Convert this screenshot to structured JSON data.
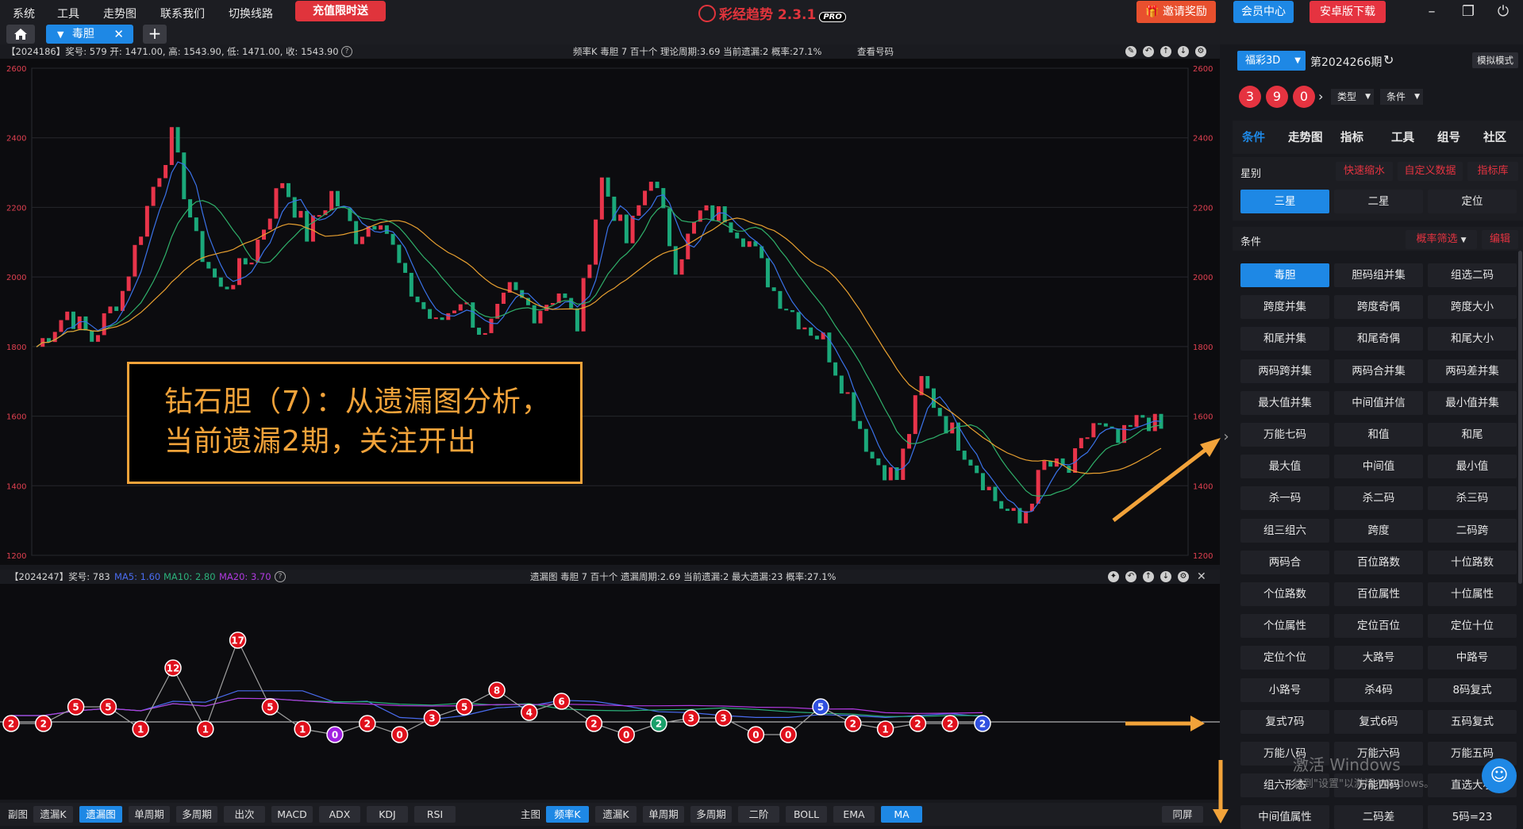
{
  "topbar": {
    "menu": [
      "系统",
      "工具",
      "走势图",
      "联系我们",
      "切换线路"
    ],
    "promo": "充值限时送",
    "app_title": "彩经趋势 2.3.1",
    "app_badge": "PRO",
    "invite": "邀请奖励",
    "member": "会员中心",
    "android": "安卓版下载"
  },
  "tabs": {
    "active": "毒胆"
  },
  "main_chart": {
    "info": "【2024186】奖号: 579  开: 1471.00, 高: 1543.90, 低: 1471.00, 收: 1543.90",
    "stats": "频率K  毒胆  7  百十个  理论周期:3.69  当前遗漏:2  概率:27.1%",
    "view_link": "查看号码"
  },
  "annotation": {
    "line1": "钻石胆（7）：从遗漏图分析，",
    "line2": "当前遗漏2期，关注开出"
  },
  "sub_chart": {
    "info": "【2024247】奖号: 783",
    "ma5": "MA5: 1.60",
    "ma10": "MA10: 2.80",
    "ma20": "MA20: 3.70",
    "stats": "遗漏图  毒胆  7  百十个  遗漏周期:2.69  当前遗漏:2  最大遗漏:23  概率:27.1%"
  },
  "bottombar": {
    "sub_label": "副图",
    "sub_buttons": [
      "遗漏K",
      "遗漏图",
      "单周期",
      "多周期",
      "出次",
      "MACD",
      "ADX",
      "KDJ",
      "RSI"
    ],
    "main_label": "主图",
    "main_buttons": [
      "频率K",
      "遗漏K",
      "单周期",
      "多周期",
      "二阶",
      "BOLL",
      "EMA",
      "MA"
    ],
    "fullscreen": "同屏"
  },
  "rightpanel": {
    "lottery": "福彩3D",
    "period": "第2024266期",
    "sim_mode": "模拟模式",
    "balls": [
      "3",
      "9",
      "0"
    ],
    "type_label": "类型",
    "cond_label": "条件",
    "tabs": [
      "条件",
      "走势图",
      "指标",
      "工具",
      "组号",
      "社区"
    ],
    "star_label": "星别",
    "star_links": [
      "快速缩水",
      "自定义数据",
      "指标库"
    ],
    "stars": [
      "三星",
      "二星",
      "定位"
    ],
    "cond_title": "条件",
    "prob_filter": "概率筛选",
    "edit": "编辑",
    "conditions": [
      "毒胆",
      "胆码组并集",
      "组选二码",
      "跨度并集",
      "跨度奇偶",
      "跨度大小",
      "和尾并集",
      "和尾奇偶",
      "和尾大小",
      "两码跨并集",
      "两码合并集",
      "两码差并集",
      "最大值并集",
      "中间值并信",
      "最小值并集",
      "万能七码",
      "和值",
      "和尾",
      "最大值",
      "中间值",
      "最小值",
      "杀一码",
      "杀二码",
      "杀三码",
      "组三组六",
      "跨度",
      "二码跨",
      "两码合",
      "百位路数",
      "十位路数",
      "个位路数",
      "百位属性",
      "十位属性",
      "个位属性",
      "定位百位",
      "定位十位",
      "定位个位",
      "大路号",
      "中路号",
      "小路号",
      "杀4码",
      "8码复式",
      "复式7码",
      "复式6码",
      "五码复式",
      "万能八码",
      "万能六码",
      "万能五码",
      "组六形态",
      "万能四码",
      "直选大小",
      "中间值属性",
      "二码差",
      "5码=23"
    ],
    "watermark1": "激活 Windows",
    "watermark2": "转到\"设置\"以激活 Windows。"
  },
  "chart_data": [
    {
      "type": "candlestick",
      "yticks": [
        2600,
        2400,
        2200,
        2000,
        1800,
        1600,
        1400,
        1200
      ],
      "ylim": [
        1200,
        2600
      ],
      "series": [
        {
          "name": "close"
        },
        {
          "name": "MA5"
        },
        {
          "name": "MA10"
        },
        {
          "name": "MA20"
        }
      ],
      "keypoints": [
        [
          0,
          1800
        ],
        [
          5,
          1900
        ],
        [
          9,
          1820
        ],
        [
          14,
          1960
        ],
        [
          19,
          2260
        ],
        [
          22,
          2400
        ],
        [
          26,
          2100
        ],
        [
          30,
          1960
        ],
        [
          35,
          2060
        ],
        [
          40,
          2280
        ],
        [
          44,
          2120
        ],
        [
          48,
          2240
        ],
        [
          52,
          2120
        ],
        [
          56,
          2180
        ],
        [
          60,
          1980
        ],
        [
          65,
          1860
        ],
        [
          69,
          1940
        ],
        [
          73,
          1820
        ],
        [
          77,
          1960
        ],
        [
          81,
          1900
        ],
        [
          85,
          1960
        ],
        [
          88,
          1860
        ],
        [
          92,
          2280
        ],
        [
          96,
          2100
        ],
        [
          100,
          2300
        ],
        [
          104,
          2040
        ],
        [
          108,
          2180
        ],
        [
          112,
          2180
        ],
        [
          116,
          2100
        ],
        [
          120,
          1960
        ],
        [
          124,
          1880
        ],
        [
          128,
          1820
        ],
        [
          132,
          1660
        ],
        [
          136,
          1480
        ],
        [
          140,
          1420
        ],
        [
          144,
          1700
        ],
        [
          148,
          1580
        ],
        [
          152,
          1480
        ],
        [
          156,
          1360
        ],
        [
          160,
          1290
        ],
        [
          164,
          1460
        ],
        [
          168,
          1440
        ],
        [
          172,
          1580
        ],
        [
          176,
          1520
        ],
        [
          180,
          1600
        ],
        [
          183,
          1560
        ]
      ]
    },
    {
      "type": "line",
      "series": [
        {
          "name": "遗漏",
          "values": [
            2,
            2,
            5,
            5,
            1,
            12,
            1,
            17,
            5,
            1,
            0,
            2,
            0,
            3,
            5,
            8,
            4,
            6,
            2,
            0,
            2,
            3,
            3,
            0,
            0,
            5,
            2,
            1,
            2,
            2,
            2
          ]
        }
      ]
    }
  ]
}
